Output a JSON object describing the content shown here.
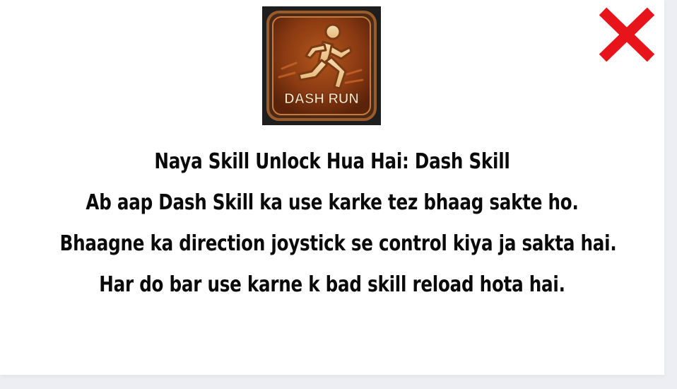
{
  "skill_icon": {
    "label": "DASH RUN",
    "icon": "running-figure-icon"
  },
  "close_icon": "close-x-icon",
  "colors": {
    "close": "#e8141c",
    "icon_bg": "#8a3a12",
    "icon_border": "#b0652f",
    "label_color": "#f5e6c8",
    "text": "#0a0a0a"
  },
  "message": {
    "title": "Naya Skill Unlock Hua Hai: Dash Skill",
    "line1": "Ab aap Dash Skill ka use karke tez bhaag sakte ho.",
    "line2": "Bhaagne ka direction joystick se control kiya ja sakta hai.",
    "line3": "Har do bar use karne k bad skill reload hota hai."
  }
}
